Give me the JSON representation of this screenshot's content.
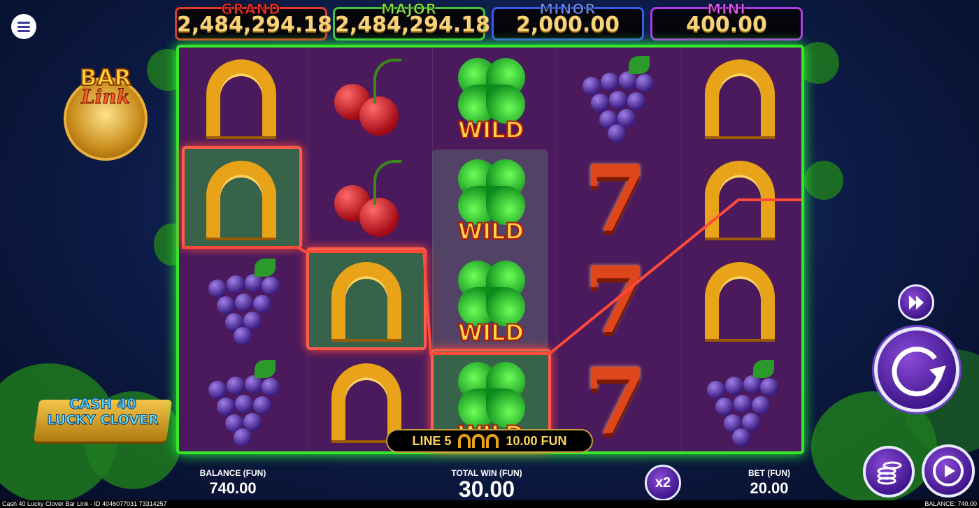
{
  "jackpots": [
    {
      "label": "GRAND",
      "value": "2,484,294.18",
      "color": "#e03a2a",
      "label_color": "#e8302a"
    },
    {
      "label": "MAJOR",
      "value": "2,484,294.18",
      "color": "#42c53a",
      "label_color": "#7be84a"
    },
    {
      "label": "MINOR",
      "value": "2,000.00",
      "color": "#3a5ae8",
      "label_color": "#5b8af8"
    },
    {
      "label": "MINI",
      "value": "400.00",
      "color": "#b03ae8",
      "label_color": "#e05af8"
    }
  ],
  "logo": {
    "line1": "BAR",
    "line2": "Link"
  },
  "game_logo": {
    "line1": "CASH 40",
    "line2": "LUCKY CLOVER"
  },
  "reels": [
    [
      "horseshoe",
      "horseshoe",
      "grapes",
      "grapes"
    ],
    [
      "cherries",
      "cherries",
      "horseshoe",
      "horseshoe"
    ],
    [
      "wild",
      "wild",
      "wild",
      "wild"
    ],
    [
      "grapes",
      "seven",
      "seven",
      "seven"
    ],
    [
      "horseshoe",
      "horseshoe",
      "horseshoe",
      "grapes"
    ]
  ],
  "wild_text": "WILD",
  "win_banner": {
    "line": "LINE 5",
    "amount": "10.00 FUN",
    "icon": "horseshoe-icon"
  },
  "hud": {
    "balance_label": "BALANCE (FUN)",
    "balance_value": "740.00",
    "total_win_label": "TOTAL WIN (FUN)",
    "total_win_value": "30.00",
    "bet_label": "BET (FUN)",
    "bet_value": "20.00",
    "multiplier": "x2"
  },
  "buttons": {
    "menu": "menu-icon",
    "fast": "fast-forward-icon",
    "spin": "spin-icon",
    "coins": "coin-stack-icon",
    "autoplay": "autoplay-icon"
  },
  "footer": {
    "left": "Cash 40 Lucky Clover Bar Link - ID 4046077031 73314257",
    "right": "BALANCE: 740.00"
  }
}
